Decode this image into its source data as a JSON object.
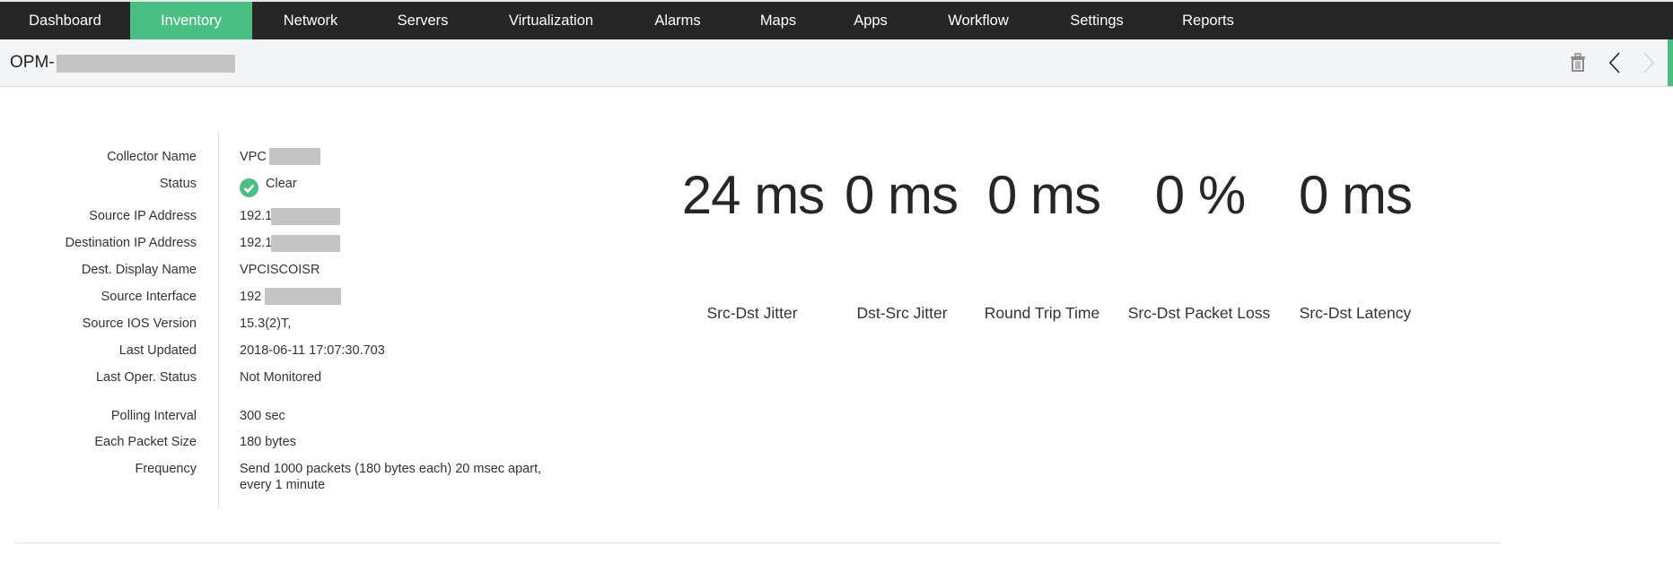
{
  "nav": {
    "tabs": [
      {
        "label": "Dashboard"
      },
      {
        "label": "Inventory",
        "active": true
      },
      {
        "label": "Network"
      },
      {
        "label": "Servers"
      },
      {
        "label": "Virtualization"
      },
      {
        "label": "Alarms"
      },
      {
        "label": "Maps"
      },
      {
        "label": "Apps"
      },
      {
        "label": "Workflow"
      },
      {
        "label": "Settings"
      },
      {
        "label": "Reports"
      }
    ]
  },
  "header": {
    "title": "OPM-",
    "icons": [
      "trash-icon",
      "chevron-left-icon",
      "chevron-right-icon"
    ]
  },
  "details": [
    {
      "label": "Collector Name",
      "value": "VPC"
    },
    {
      "label": "Status",
      "value": "Clear"
    },
    {
      "label": "Source IP Address",
      "value": "192.1"
    },
    {
      "label": "Destination IP Address",
      "value": "192.1"
    },
    {
      "label": "Dest. Display Name",
      "value": "VPCISCOISR"
    },
    {
      "label": "Source Interface",
      "value": "192"
    },
    {
      "label": "Source IOS Version",
      "value": "15.3(2)T,"
    },
    {
      "label": "Last Updated",
      "value": "2018-06-11 17:07:30.703"
    },
    {
      "label": "Last Oper. Status",
      "value": "Not Monitored"
    },
    {
      "label": "Polling Interval",
      "value": "300 sec"
    },
    {
      "label": "Each Packet Size",
      "value": "180 bytes"
    },
    {
      "label": "Frequency",
      "value": "Send 1000 packets (180 bytes each) 20 msec apart,",
      "value2": "every 1 minute"
    }
  ],
  "metrics": [
    {
      "value": "24 ms",
      "label": "Src-Dst Jitter"
    },
    {
      "value": "0 ms",
      "label": "Dst-Src Jitter"
    },
    {
      "value": "0 ms",
      "label": "Round Trip Time"
    },
    {
      "value": "0 %",
      "label": "Src-Dst Packet Loss"
    },
    {
      "value": "0 ms",
      "label": "Src-Dst Latency"
    }
  ],
  "colors": {
    "accent": "#4bbf83",
    "nav_bg": "#262626",
    "status_clear": "#4bbf83"
  }
}
